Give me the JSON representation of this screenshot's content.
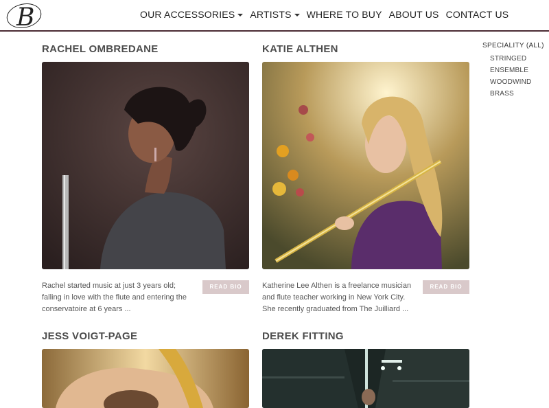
{
  "header": {
    "logo_letter": "B",
    "nav": [
      {
        "label": "OUR ACCESSORIES",
        "dropdown": true
      },
      {
        "label": "ARTISTS",
        "dropdown": true
      },
      {
        "label": "WHERE TO BUY",
        "dropdown": false
      },
      {
        "label": "ABOUT US",
        "dropdown": false
      },
      {
        "label": "CONTACT US",
        "dropdown": false
      }
    ]
  },
  "sidebar": {
    "title": "SPECIALITY",
    "all_label": "(ALL)",
    "items": [
      "STRINGED",
      "ENSEMBLE",
      "WOODWIND",
      "BRASS"
    ]
  },
  "artists": [
    {
      "name": "RACHEL OMBREDANE",
      "bio": "Rachel started music at just 3 years old; falling in love with the flute and entering the conservatoire at 6 years ...",
      "button": "READ BIO"
    },
    {
      "name": "KATIE ALTHEN",
      "bio": "Katherine Lee Althen is a freelance musician and flute teacher working in New York City. She recently graduated from The Juilliard ...",
      "button": "READ BIO"
    },
    {
      "name": "JESS VOIGT-PAGE"
    },
    {
      "name": "DEREK FITTING"
    }
  ],
  "colors": {
    "header_rule": "#4a2a33",
    "button_bg": "#d9c9ca"
  }
}
